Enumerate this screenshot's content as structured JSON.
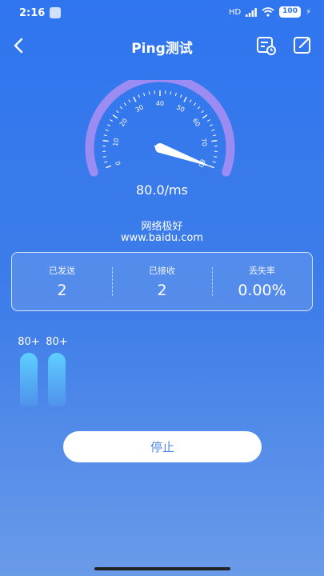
{
  "status": {
    "time": "2:16",
    "signal": "HD",
    "battery": "100"
  },
  "header": {
    "title": "Ping测试"
  },
  "gauge": {
    "ticks": [
      "0",
      "10",
      "20",
      "30",
      "40",
      "50",
      "60",
      "70",
      "80"
    ],
    "needle_value": 80,
    "max": 80
  },
  "result": {
    "speed": "80.0/ms",
    "quality": "网络极好",
    "host": "www.baidu.com"
  },
  "stats": [
    {
      "label": "已发送",
      "value": "2"
    },
    {
      "label": "已接收",
      "value": "2"
    },
    {
      "label": "丢失率",
      "value": "0.00%"
    }
  ],
  "history": [
    {
      "label": "80+"
    },
    {
      "label": "80+"
    }
  ],
  "actions": {
    "stop_label": "停止"
  },
  "colors": {
    "background": "#2f75ef",
    "gauge_arc": "#9a8cf3",
    "bar": "#5fd0ff"
  }
}
